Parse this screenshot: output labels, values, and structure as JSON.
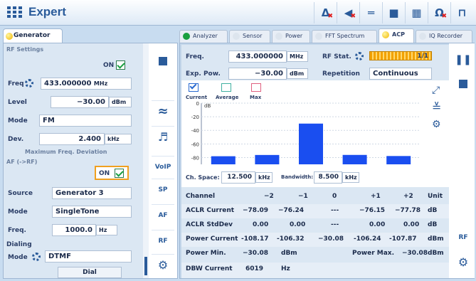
{
  "app": {
    "title": "Expert"
  },
  "toolbar_icons": [
    "delta-marker-icon",
    "mute-icon",
    "attenuator-icon",
    "stop-icon",
    "layout-icon",
    "ohm-icon",
    "trigger-icon"
  ],
  "generator": {
    "tab": "Generator",
    "rf_settings": "RF Settings",
    "on_label": "ON",
    "freq_label": "Freq",
    "freq_value": "433.000000",
    "freq_unit": "MHz",
    "level_label": "Level",
    "level_value": "−30.00",
    "level_unit": "dBm",
    "mode_label": "Mode",
    "mode_value": "FM",
    "dev_label": "Dev.",
    "dev_value": "2.400",
    "dev_unit": "kHz",
    "max_dev": "Maximum Freq. Deviation",
    "af_label": "AF (->RF)",
    "af_on": "ON",
    "source_label": "Source",
    "source_value": "Generator 3",
    "af_mode_label": "Mode",
    "af_mode_value": "SingleTone",
    "af_freq_label": "Freq.",
    "af_freq_value": "1000.0",
    "af_freq_unit": "Hz",
    "dialing": "Dialing",
    "dial_mode_label": "Mode",
    "dial_mode_value": "DTMF",
    "dial_button": "Dial"
  },
  "side_buttons": [
    "VoIP",
    "SP",
    "AF",
    "RF"
  ],
  "tabs": [
    "Analyzer",
    "Sensor",
    "Power",
    "FFT Spectrum",
    "ACP",
    "IQ Recorder"
  ],
  "acp": {
    "freq_label": "Freq.",
    "freq_value": "433.000000",
    "freq_unit": "MHz",
    "rf_stat": "RF Stat.",
    "rf_stat_value": "1/1",
    "exp_pow_label": "Exp. Pow.",
    "exp_pow_value": "−30.00",
    "exp_pow_unit": "dBm",
    "repetition_label": "Repetition",
    "repetition_value": "Continuous",
    "legend": [
      "Current",
      "Average",
      "Max"
    ],
    "ch_space_label": "Ch. Space:",
    "ch_space_value": "12.500",
    "ch_space_unit": "kHz",
    "bandwidth_label": "Bandwidth:",
    "bandwidth_value": "8.500",
    "bandwidth_unit": "kHz"
  },
  "chart_data": {
    "type": "bar",
    "ylabel": "dB",
    "yticks": [
      "0",
      "-20",
      "-40",
      "-60",
      "-80"
    ],
    "ylim": [
      -90,
      0
    ],
    "categories": [
      "-2",
      "-1",
      "0",
      "+1",
      "+2"
    ],
    "values": [
      -78.09,
      -76.24,
      -30.08,
      -76.15,
      -77.78
    ],
    "legend": [
      "Current",
      "Average",
      "Max"
    ]
  },
  "table": {
    "header": [
      "Channel",
      "−2",
      "−1",
      "0",
      "+1",
      "+2",
      "Unit"
    ],
    "rows": [
      [
        "ACLR  Current",
        "−78.09",
        "−76.24",
        "---",
        "−76.15",
        "−77.78",
        "dB"
      ],
      [
        "ACLR  StdDev",
        "0.00",
        "0.00",
        "---",
        "0.00",
        "0.00",
        "dB"
      ],
      [
        "Power Current",
        "-108.17",
        "-106.32",
        "−30.08",
        "-106.24",
        "-107.87",
        "dBm"
      ]
    ],
    "power_min_label": "Power Min.",
    "power_min_value": "−30.08",
    "power_min_unit": "dBm",
    "power_max_label": "Power Max.",
    "power_max_value": "−30.08",
    "power_max_unit": "dBm",
    "dbw_label": "DBW Current",
    "dbw_value": "6019",
    "dbw_unit": "Hz"
  }
}
